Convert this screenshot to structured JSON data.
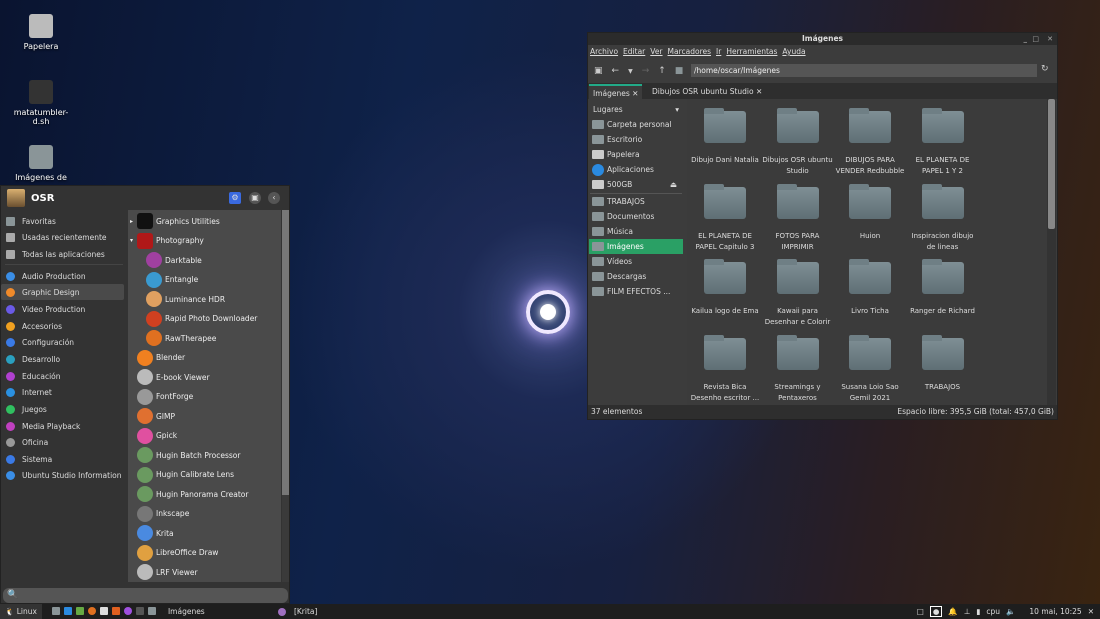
{
  "desktop": {
    "icons": [
      {
        "label": "Papelera",
        "icon": "trash-icon"
      },
      {
        "label": "matatumbler-d.sh",
        "icon": "script-icon"
      },
      {
        "label": "Imágenes de",
        "icon": "folder-icon"
      }
    ]
  },
  "menu": {
    "user": "OSR",
    "settings_icon": "gear-icon",
    "lock_icon": "lock-icon",
    "back_icon": "chevron-left-icon",
    "categories": [
      {
        "label": "Favoritas",
        "color": "#8a9598"
      },
      {
        "label": "Usadas recientemente",
        "color": "#aaa"
      },
      {
        "label": "Todas las aplicaciones",
        "color": "#aaa"
      },
      {
        "label": "Audio Production",
        "color": "#3a8ee6"
      },
      {
        "label": "Graphic Design",
        "color": "#f08a2a",
        "selected": true
      },
      {
        "label": "Video Production",
        "color": "#6a5ae6"
      },
      {
        "label": "Accesorios",
        "color": "#f0a020"
      },
      {
        "label": "Configuración",
        "color": "#3a7ae6"
      },
      {
        "label": "Desarrollo",
        "color": "#2aa0c0"
      },
      {
        "label": "Educación",
        "color": "#b040d0"
      },
      {
        "label": "Internet",
        "color": "#2a90e0"
      },
      {
        "label": "Juegos",
        "color": "#30c060"
      },
      {
        "label": "Media Playback",
        "color": "#c040c0"
      },
      {
        "label": "Oficina",
        "color": "#999"
      },
      {
        "label": "Sistema",
        "color": "#3a7ae6"
      },
      {
        "label": "Ubuntu Studio Information",
        "color": "#3a8ee6"
      }
    ],
    "apps": [
      {
        "label": "Graphics Utilities",
        "group": true,
        "expanded": false,
        "color": "#111"
      },
      {
        "label": "Photography",
        "group": true,
        "expanded": true,
        "color": "#b01818"
      },
      {
        "label": "Darktable",
        "sub": true,
        "color": "#a040a0"
      },
      {
        "label": "Entangle",
        "sub": true,
        "color": "#3a9ad0"
      },
      {
        "label": "Luminance HDR",
        "sub": true,
        "color": "#e0a060"
      },
      {
        "label": "Rapid Photo Downloader",
        "sub": true,
        "color": "#d04020"
      },
      {
        "label": "RawTherapee",
        "sub": true,
        "color": "#e07020"
      },
      {
        "label": "Blender",
        "color": "#f08020"
      },
      {
        "label": "E-book Viewer",
        "color": "#bbb"
      },
      {
        "label": "FontForge",
        "color": "#999"
      },
      {
        "label": "GIMP",
        "color": "#e07030"
      },
      {
        "label": "Gpick",
        "color": "#e050a0"
      },
      {
        "label": "Hugin Batch Processor",
        "color": "#6a9a60"
      },
      {
        "label": "Hugin Calibrate Lens",
        "color": "#6a9a60"
      },
      {
        "label": "Hugin Panorama Creator",
        "color": "#6a9a60"
      },
      {
        "label": "Inkscape",
        "color": "#777"
      },
      {
        "label": "Krita",
        "color": "#4a8ae0"
      },
      {
        "label": "LibreOffice Draw",
        "color": "#e0a040"
      },
      {
        "label": "LRF Viewer",
        "color": "#bbb"
      }
    ],
    "search_placeholder": "🔍"
  },
  "taskbar": {
    "start_label": "Linux",
    "windows": [
      "Imágenes",
      "[Krita]"
    ],
    "cpu_label": "cpu",
    "clock": "10 mai, 10:25"
  },
  "filemanager": {
    "title": "Imágenes",
    "menu": [
      "Archivo",
      "Editar",
      "Ver",
      "Marcadores",
      "Ir",
      "Herramientas",
      "Ayuda"
    ],
    "path": "/home/oscar/Imágenes",
    "tabs": [
      {
        "label": "Imágenes",
        "active": true
      },
      {
        "label": "Dibujos OSR ubuntu Studio"
      }
    ],
    "places_header": "Lugares",
    "places": [
      {
        "label": "Carpeta personal"
      },
      {
        "label": "Escritorio"
      },
      {
        "label": "Papelera"
      },
      {
        "label": "Aplicaciones"
      },
      {
        "label": "500GB",
        "eject": true
      },
      {
        "label": "TRABAJOS"
      },
      {
        "label": "Documentos"
      },
      {
        "label": "Música"
      },
      {
        "label": "Imágenes",
        "selected": true
      },
      {
        "label": "Vídeos"
      },
      {
        "label": "Descargas"
      },
      {
        "label": "FILM EFECTOS ..."
      }
    ],
    "folders": [
      "Dibujo Dani Natalia",
      "Dibujos OSR ubuntu Studio",
      "DIBUJOS PARA VENDER Redbubble",
      "EL PLANETA DE PAPEL 1 Y 2",
      "EL PLANETA DE PAPEL Capitulo 3",
      "FOTOS PARA IMPRIMIR",
      "Huion",
      "Inspiracion dibujo de lineas",
      "Kailua logo de Ema",
      "Kawaii para Desenhar e Colorir",
      "Livro Ticha",
      "Ranger de Richard",
      "Revista Bica Desenho escritor ...",
      "Streamings y Pentaxeros",
      "Susana Loio Sao Gemil 2021",
      "TRABAJOS"
    ],
    "status_count": "37 elementos",
    "status_space": "Espacio libre: 395,5 GiB (total: 457,0 GiB)"
  }
}
